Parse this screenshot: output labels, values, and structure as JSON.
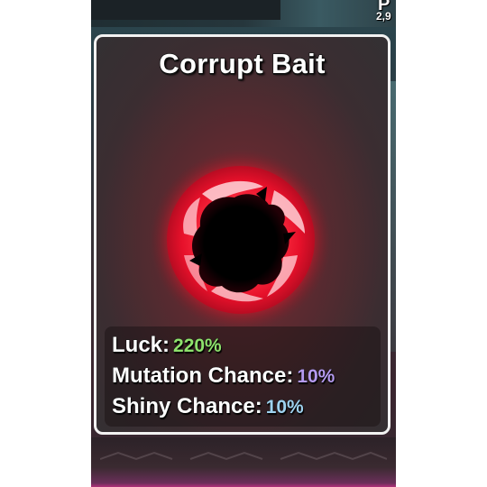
{
  "hud": {
    "corner_letter": "P",
    "corner_number": "2,9"
  },
  "item_card": {
    "title": "Corrupt Bait",
    "icon": "corrupt-bait-orb-icon",
    "stats": [
      {
        "label": "Luck:",
        "value": "220%",
        "value_color": "#8ee06c"
      },
      {
        "label": "Mutation Chance:",
        "value": "10%",
        "value_color": "#b59af0"
      },
      {
        "label": "Shiny Chance:",
        "value": "10%",
        "value_color": "#9fd2ef"
      }
    ]
  },
  "colors": {
    "card_border": "#f2f2f2",
    "orb_glow": "#ff2a3a",
    "luck_value": "#8ee06c",
    "mutation_value": "#b59af0",
    "shiny_value": "#9fd2ef"
  }
}
